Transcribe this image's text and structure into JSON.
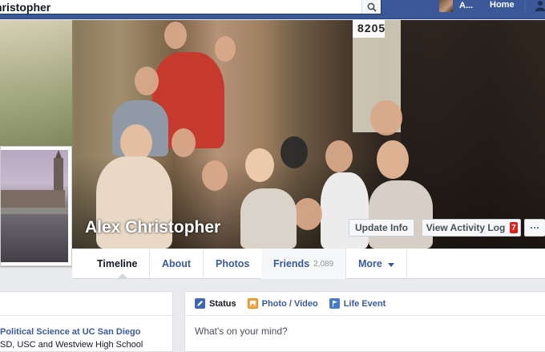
{
  "topbar": {
    "search_value": "hristopher",
    "user_name": "A...",
    "home_label": "Home"
  },
  "cover": {
    "house_number": "8205",
    "name": "Alex Christopher"
  },
  "actions": {
    "update_info": "Update Info",
    "activity_log": "View Activity Log",
    "activity_badge": "7",
    "more": "···"
  },
  "tabs": [
    {
      "label": "Timeline"
    },
    {
      "label": "About"
    },
    {
      "label": "Photos"
    },
    {
      "label": "Friends",
      "count": "2,089"
    },
    {
      "label": "More"
    }
  ],
  "about": {
    "line1_prefix": "Political Science at ",
    "line1_school": "UC San Diego",
    "line2": "SD, USC and Westview High School"
  },
  "composer": {
    "tabs": [
      {
        "label": "Status"
      },
      {
        "label": "Photo / Video"
      },
      {
        "label": "Life Event"
      }
    ],
    "placeholder": "What's on your mind?"
  },
  "colors": {
    "brand_blue": "#3b5998",
    "badge_red": "#e02020"
  }
}
